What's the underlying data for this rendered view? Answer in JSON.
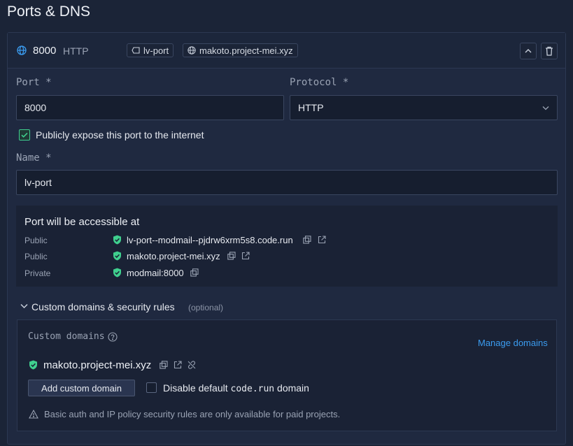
{
  "page": {
    "title": "Ports & DNS"
  },
  "port_card": {
    "port_number": "8000",
    "protocol_tag": "HTTP",
    "name_chip": "lv-port",
    "domain_chip": "makoto.project-mei.xyz"
  },
  "form": {
    "port_label": "Port *",
    "port_value": "8000",
    "protocol_label": "Protocol *",
    "protocol_value": "HTTP",
    "expose_label": "Publicly expose this port to the internet",
    "expose_checked": true,
    "name_label": "Name *",
    "name_value": "lv-port"
  },
  "access": {
    "heading": "Port will be accessible at",
    "rows": [
      {
        "kind": "Public",
        "address": "lv-port--modmail--pjdrw6xrm5s8.code.run"
      },
      {
        "kind": "Public",
        "address": "makoto.project-mei.xyz"
      },
      {
        "kind": "Private",
        "address": "modmail:8000"
      }
    ]
  },
  "custom": {
    "section_title": "Custom domains & security rules",
    "section_hint": "(optional)",
    "domains_label": "Custom domains",
    "manage_link": "Manage domains",
    "domain": "makoto.project-mei.xyz",
    "add_button": "Add custom domain",
    "disable_prefix": "Disable default",
    "disable_code": "code.run",
    "disable_suffix": "domain",
    "notice": "Basic auth and IP policy security rules are only available for paid projects."
  },
  "colors": {
    "background": "#1b2437",
    "accent_blue": "#3b9cf0",
    "success_green": "#3fcf8e"
  }
}
